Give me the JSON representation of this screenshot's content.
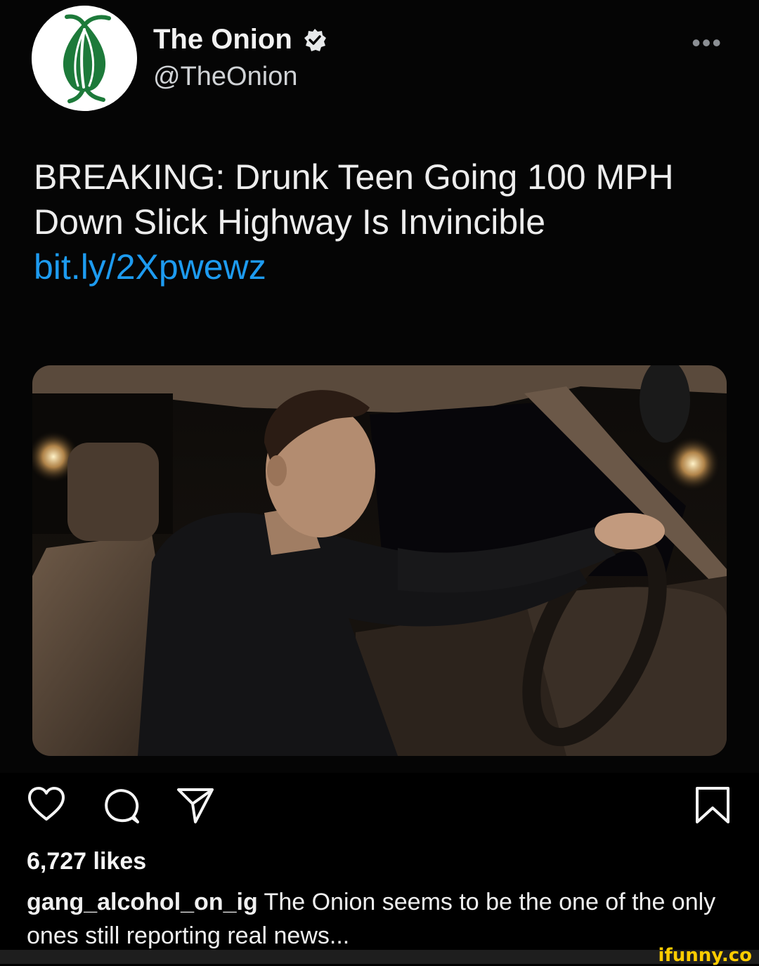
{
  "tweet": {
    "display_name": "The Onion",
    "handle": "@TheOnion",
    "verified": true,
    "more_icon": "ellipsis-icon",
    "text_main": "BREAKING: Drunk Teen Going 100 MPH Down Slick Highway Is Invincible",
    "link": "bit.ly/2Xpwewz",
    "link_color": "#1d9bf0",
    "avatar_icon": "onion-logo-icon",
    "media_image": "young-man-driving-car-at-night"
  },
  "post": {
    "actions": [
      {
        "icon": "heart-icon"
      },
      {
        "icon": "comment-icon"
      },
      {
        "icon": "share-icon"
      },
      {
        "icon": "bookmark-icon"
      }
    ],
    "likes": "6,727 likes",
    "caption_user": "gang_alcohol_on_ig",
    "caption_text": " The Onion seems to be the one of the only ones still reporting real news..."
  },
  "watermark": "ifunny.co",
  "colors": {
    "background": "#000000",
    "onion_green": "#1d7a3a",
    "watermark": "#ffcc00"
  }
}
